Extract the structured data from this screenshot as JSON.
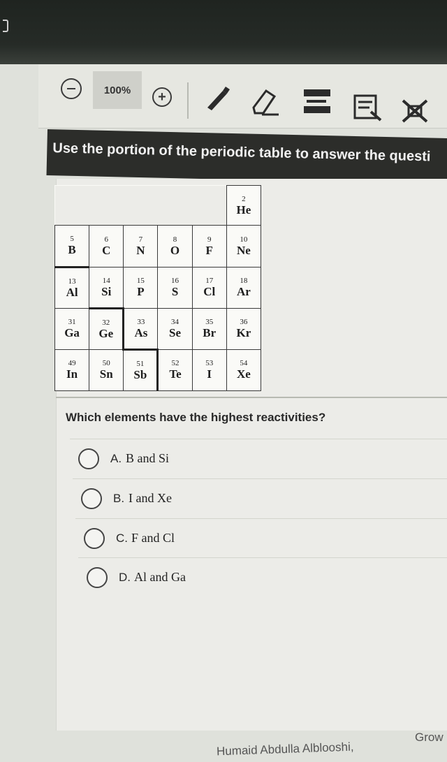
{
  "toolbar": {
    "zoom_level": "100%",
    "icons": [
      "zoom-out-icon",
      "zoom-in-icon",
      "pencil-icon",
      "eraser-icon",
      "highlighter-icon",
      "reference-icon",
      "eliminate-icon"
    ]
  },
  "question": {
    "instruction": "Use the portion of the periodic table to answer the questi",
    "prompt": "Which elements have the highest reactivities?"
  },
  "periodic_table": {
    "rows": [
      [
        null,
        null,
        null,
        null,
        null,
        {
          "num": "2",
          "sym": "He"
        }
      ],
      [
        {
          "num": "5",
          "sym": "B"
        },
        {
          "num": "6",
          "sym": "C"
        },
        {
          "num": "7",
          "sym": "N"
        },
        {
          "num": "8",
          "sym": "O"
        },
        {
          "num": "9",
          "sym": "F"
        },
        {
          "num": "10",
          "sym": "Ne"
        }
      ],
      [
        {
          "num": "13",
          "sym": "Al"
        },
        {
          "num": "14",
          "sym": "Si"
        },
        {
          "num": "15",
          "sym": "P"
        },
        {
          "num": "16",
          "sym": "S"
        },
        {
          "num": "17",
          "sym": "Cl"
        },
        {
          "num": "18",
          "sym": "Ar"
        }
      ],
      [
        {
          "num": "31",
          "sym": "Ga"
        },
        {
          "num": "32",
          "sym": "Ge"
        },
        {
          "num": "33",
          "sym": "As"
        },
        {
          "num": "34",
          "sym": "Se"
        },
        {
          "num": "35",
          "sym": "Br"
        },
        {
          "num": "36",
          "sym": "Kr"
        }
      ],
      [
        {
          "num": "49",
          "sym": "In"
        },
        {
          "num": "50",
          "sym": "Sn"
        },
        {
          "num": "51",
          "sym": "Sb"
        },
        {
          "num": "52",
          "sym": "Te"
        },
        {
          "num": "53",
          "sym": "I"
        },
        {
          "num": "54",
          "sym": "Xe"
        }
      ]
    ]
  },
  "choices": [
    {
      "letter": "A.",
      "text": "B and Si"
    },
    {
      "letter": "B.",
      "text": "I and Xe"
    },
    {
      "letter": "C.",
      "text": "F and Cl"
    },
    {
      "letter": "D.",
      "text": "Al and Ga"
    }
  ],
  "footer": {
    "student_name": "Humaid Abdulla Alblooshi,",
    "right_text": "Grow"
  },
  "colors": {
    "question_bar": "#2c2d2a",
    "toolbar_bg": "#e6e7e1",
    "top_dark": "#1f2420"
  }
}
